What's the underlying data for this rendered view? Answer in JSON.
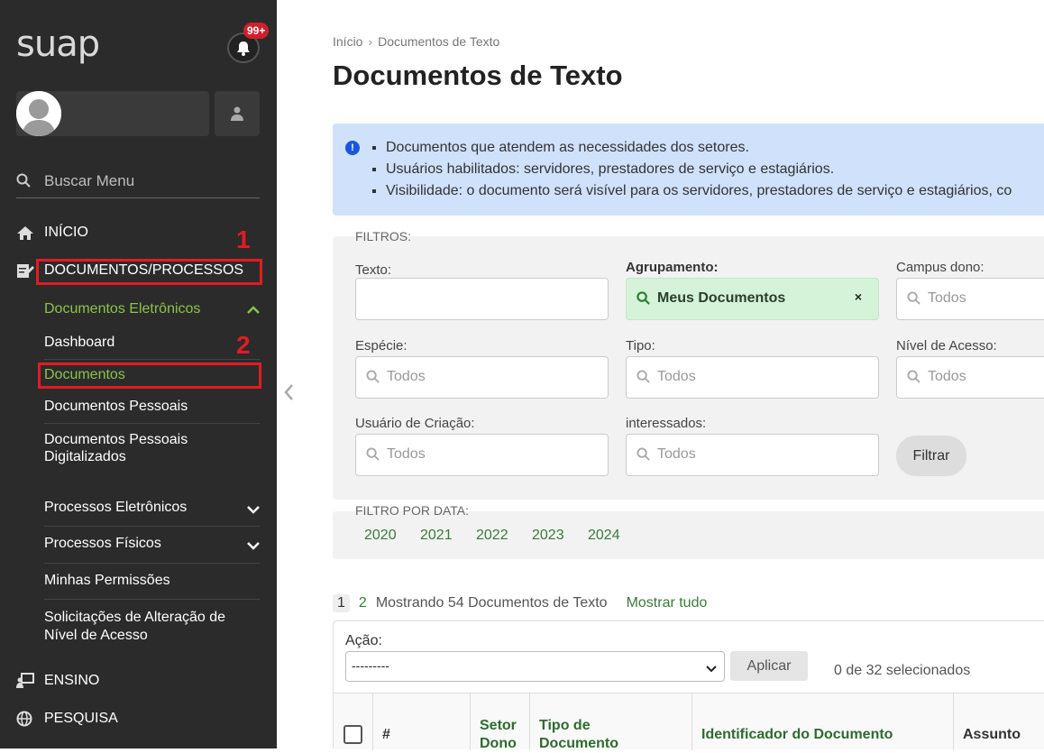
{
  "sidebar": {
    "logo": "suap",
    "notification_badge": "99+",
    "search_label": "Buscar Menu",
    "nav": [
      {
        "label": "INÍCIO",
        "icon": "home-icon"
      },
      {
        "label": "DOCUMENTOS/PROCESSOS",
        "icon": "document-edit-icon"
      },
      {
        "label": "ENSINO",
        "icon": "teaching-icon"
      },
      {
        "label": "PESQUISA",
        "icon": "globe-icon"
      }
    ],
    "section_header": "Documentos Eletrônicos",
    "sub_items": [
      "Dashboard",
      "Documentos",
      "Documentos Pessoais",
      "Documentos Pessoais Digitalizados"
    ],
    "more_items": [
      "Processos Eletrônicos",
      "Processos Físicos",
      "Minhas Permissões",
      "Solicitações de Alteração de Nível de Acesso"
    ],
    "annotations": [
      "1",
      "2"
    ]
  },
  "breadcrumb": {
    "home": "Início",
    "current": "Documentos de Texto"
  },
  "page_title": "Documentos de Texto",
  "info": [
    "Documentos que atendem as necessidades dos setores.",
    "Usuários habilitados: servidores, prestadores de serviço e estagiários.",
    "Visibilidade: o documento será visível para os servidores, prestadores de serviço e estagiários, co"
  ],
  "filters": {
    "title": "FILTROS:",
    "texto_label": "Texto:",
    "agrupamento_label": "Agrupamento:",
    "agrupamento_value": "Meus Documentos",
    "campus_label": "Campus dono:",
    "especie_label": "Espécie:",
    "tipo_label": "Tipo:",
    "nivel_label": "Nível de Acesso:",
    "usuario_label": "Usuário de Criação:",
    "interessados_label": "interessados:",
    "placeholder": "Todos",
    "button": "Filtrar"
  },
  "date_filter": {
    "title": "FILTRO POR DATA:",
    "years": [
      "2020",
      "2021",
      "2022",
      "2023",
      "2024"
    ]
  },
  "pager": {
    "current": "1",
    "next": "2",
    "summary": "Mostrando 54 Documentos de Texto",
    "show_all": "Mostrar tudo"
  },
  "actions": {
    "label": "Ação:",
    "selected": "---------",
    "apply": "Aplicar",
    "count": "0 de 32 selecionados"
  },
  "table": {
    "headers": [
      "#",
      "Setor Dono",
      "Tipo de Documento",
      "Identificador do Documento",
      "Assunto"
    ]
  }
}
